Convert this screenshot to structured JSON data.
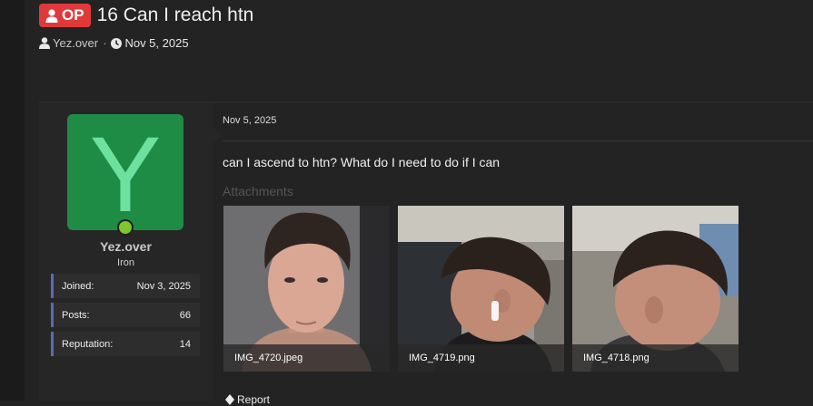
{
  "thread": {
    "op_badge": "OP",
    "title": "16 Can I reach htn",
    "author": "Yez.over",
    "separator": "·",
    "date": "Nov 5, 2025"
  },
  "user": {
    "avatar_letter": "Y",
    "name": "Yez.over",
    "rank": "Iron",
    "stats": [
      {
        "label": "Joined:",
        "value": "Nov 3, 2025"
      },
      {
        "label": "Posts:",
        "value": "66"
      },
      {
        "label": "Reputation:",
        "value": "14"
      }
    ]
  },
  "post": {
    "date": "Nov 5, 2025",
    "body": "can I ascend to htn? What do I need to do if I can",
    "attachments_label": "Attachments",
    "attachments": [
      {
        "filename": "IMG_4720.jpeg"
      },
      {
        "filename": "IMG_4719.png"
      },
      {
        "filename": "IMG_4718.png"
      }
    ],
    "report_label": "Report"
  },
  "colors": {
    "op_badge": "#e0393b",
    "avatar_bg": "#1f8c45",
    "avatar_letter": "#6ee0a0",
    "online": "#7fc52d",
    "stat_accent": "#5b6bb5"
  }
}
